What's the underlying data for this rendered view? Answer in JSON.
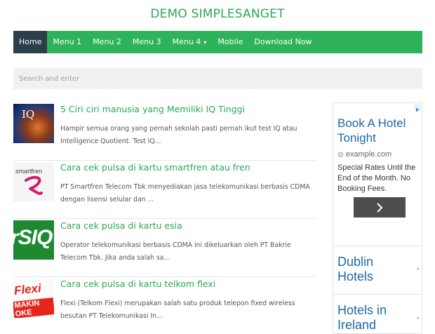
{
  "site": {
    "title": "DEMO SIMPLESANGET"
  },
  "nav": {
    "items": [
      {
        "label": "Home",
        "active": true
      },
      {
        "label": "Menu 1"
      },
      {
        "label": "Menu 2"
      },
      {
        "label": "Menu 3"
      },
      {
        "label": "Menu 4",
        "dropdown": true,
        "caret": "▾"
      },
      {
        "label": "Mobile"
      },
      {
        "label": "Download Now"
      }
    ]
  },
  "search": {
    "placeholder": "Search and enter",
    "value": ""
  },
  "posts": [
    {
      "title": "5 Ciri ciri manusia yang Memiliki IQ Tinggi",
      "excerpt": "Hampir semua orang yang pernah sekolah pasti pernah ikut test IQ atau Intelligence Quotient. Test IQ...",
      "thumb_text": "IQ"
    },
    {
      "title": "Cara cek pulsa di kartu smartfren atau fren",
      "excerpt": "PT Smartfren Telecom Tbk menyediakan jasa telekomunikasi berbasis CDMA dengan lisensi selular  dan   ...",
      "thumb_text": "smartfren"
    },
    {
      "title": "Cara cek pulsa di kartu esia",
      "excerpt": "Operator telekomunikasi berbasis CDMA ini dikeluarkan oleh PT Bakrie Telecom Tbk. Jika anda salah sa...",
      "thumb_text": "esia"
    },
    {
      "title": "Cara cek pulsa di kartu telkom flexi",
      "excerpt": "Flexi (Telkom Flexi) merupakan salah satu produk telepon fixed wireless besutan PT Telekomunikasi In...",
      "thumb_text": "Flexi"
    }
  ],
  "ad": {
    "headline": "Book A Hotel Tonight",
    "url": "example.com",
    "body": "Special Rates Until the End of the Month. No Booking Fees.",
    "button_icon": "chevron-right-icon",
    "links": [
      "Dublin Hotels",
      "Hotels in Ireland"
    ]
  },
  "colors": {
    "accent": "#2eb35a",
    "nav_active": "#2b3e4a",
    "title": "#27a85a",
    "ad_link": "#1a6aa6"
  }
}
